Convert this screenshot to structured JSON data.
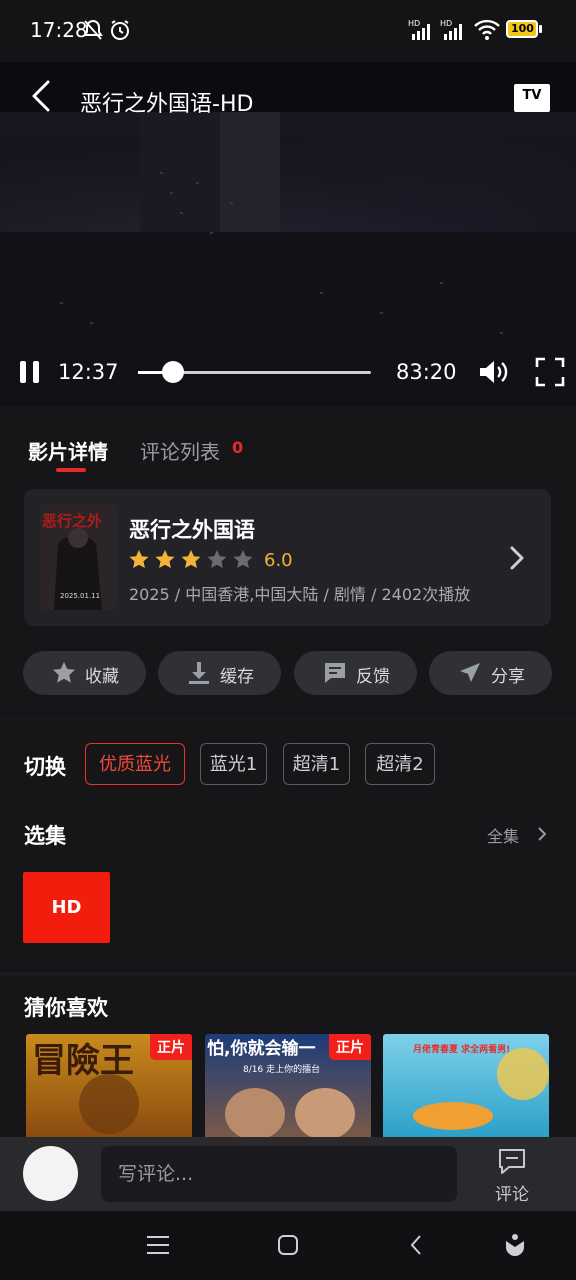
{
  "status_bar": {
    "time": "17:28",
    "battery": "100"
  },
  "player": {
    "title": "恶行之外国语-HD",
    "tv_label": "TV",
    "current_time": "12:37",
    "duration": "83:20",
    "progress": 0.15
  },
  "tabs": {
    "detail": "影片详情",
    "comments": "评论列表",
    "comments_count": "0"
  },
  "movie": {
    "name": "恶行之外国语",
    "rating": "6.0",
    "stars_filled": 3,
    "stars_total": 5,
    "meta": "2025 / 中国香港,中国大陆 / 剧情 / 2402次播放",
    "poster_title": "恶行之外",
    "poster_date": "2025.01.11"
  },
  "actions": {
    "favorite": "收藏",
    "download": "缓存",
    "feedback": "反馈",
    "share": "分享"
  },
  "switch": {
    "label": "切换",
    "sources": [
      "优质蓝光",
      "蓝光1",
      "超清1",
      "超清2"
    ]
  },
  "episodes": {
    "label": "选集",
    "all": "全集",
    "items": [
      "HD"
    ]
  },
  "recommend": {
    "label": "猜你喜欢",
    "badge": "正片",
    "items": [
      {
        "thumb_text": "冒險王",
        "badge": "正片"
      },
      {
        "thumb_text": "怕,你就会输一",
        "thumb_sub": "8/16 走上你的擂台",
        "badge": "正片"
      },
      {
        "thumb_text": "月佬青春夏 求全两看男!"
      }
    ]
  },
  "comment_bar": {
    "placeholder": "写评论...",
    "button_label": "评论"
  },
  "colors": {
    "accent": "#e52a2a",
    "star": "#f0b43a",
    "background": "#161619"
  }
}
